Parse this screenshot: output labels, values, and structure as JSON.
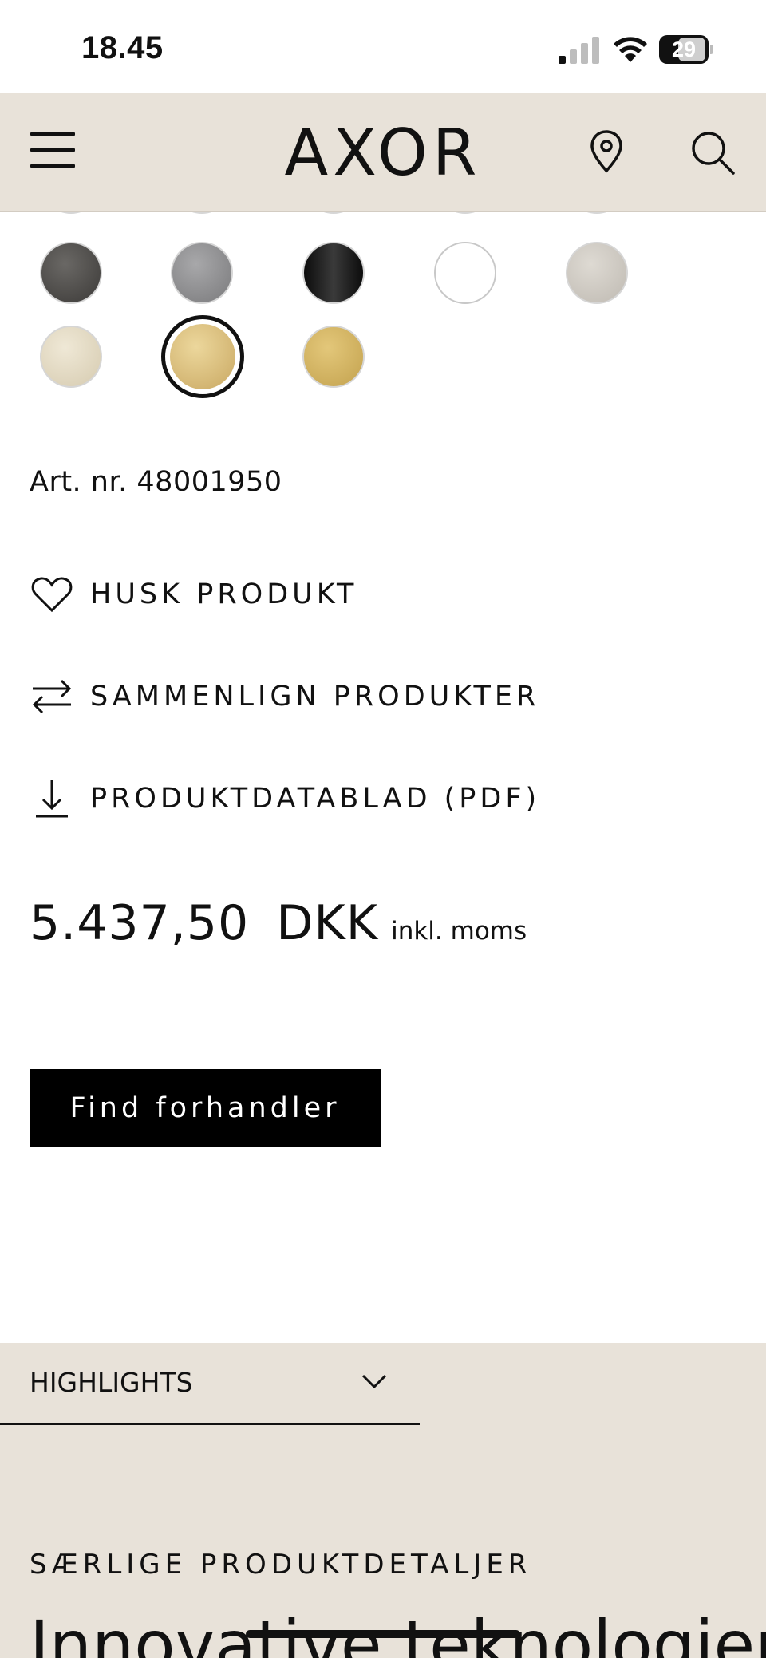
{
  "status_bar": {
    "time": "18.45",
    "battery": "29"
  },
  "header": {
    "logo": "AXOR"
  },
  "swatches": {
    "top_row_partial": [
      "#c9c9cc",
      "#b89a7a",
      "#c9a56a",
      "#e2bda0",
      "#c89a78"
    ],
    "row1": [
      "#4a4845",
      "#8e8e90",
      "#1f1e1f",
      "#ffffff",
      "#cfcac3"
    ],
    "row2": [
      "#e3dbc5",
      "#d6bb7e",
      "#cdae60"
    ],
    "selected_index_row2": 1
  },
  "product": {
    "article_number": "Art. nr. 48001950",
    "actions": [
      {
        "label": "HUSK PRODUKT",
        "icon": "heart-icon"
      },
      {
        "label": "SAMMENLIGN PRODUKTER",
        "icon": "compare-arrows-icon"
      },
      {
        "label": "PRODUKTDATABLAD (PDF)",
        "icon": "download-icon"
      }
    ],
    "price_amount": "5.437,50",
    "price_currency": "DKK",
    "price_vat": "inkl. moms",
    "dealer_button": "Find forhandler"
  },
  "sections": {
    "highlights_label": "HIGHLIGHTS",
    "special_title": "SÆRLIGE PRODUKTDETALJER",
    "big_heading": "Innovative teknologier"
  },
  "colors": {
    "header_bg": "#e8e2d9",
    "button_bg": "#000000"
  }
}
